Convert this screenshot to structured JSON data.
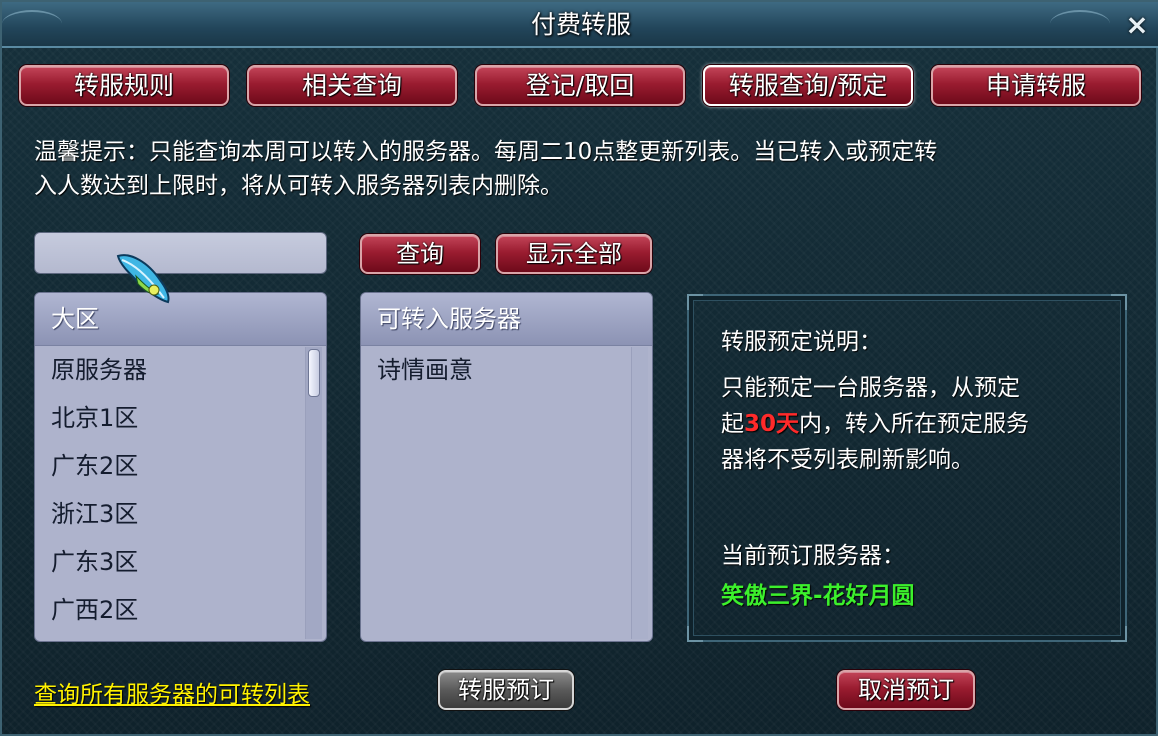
{
  "window": {
    "title": "付费转服",
    "close_label": "×"
  },
  "tabs": [
    {
      "label": "转服规则"
    },
    {
      "label": "相关查询"
    },
    {
      "label": "登记/取回"
    },
    {
      "label": "转服查询/预定",
      "selected": true
    },
    {
      "label": "申请转服"
    }
  ],
  "notice": {
    "line1": "温馨提示：只能查询本周可以转入的服务器。每周二10点整更新列表。当已转入或预定转",
    "line2": "入人数达到上限时，将从可转入服务器列表内删除。"
  },
  "search": {
    "value": "",
    "query_label": "查询",
    "show_all_label": "显示全部"
  },
  "region_list": {
    "header": "大区",
    "items": [
      "原服务器",
      "北京1区",
      "广东2区",
      "浙江3区",
      "广东3区",
      "广西2区"
    ]
  },
  "server_list": {
    "header": "可转入服务器",
    "items": [
      "诗情画意"
    ]
  },
  "info": {
    "heading": "转服预定说明：",
    "line1": "只能预定一台服务器，从预定",
    "line2_prefix": "起",
    "line2_highlight": "30天",
    "line2_suffix": "内，转入所在预定服务",
    "line3": "器将不受列表刷新影响。",
    "current_label": "当前预订服务器：",
    "current_value": "笑傲三界-花好月圆"
  },
  "footer": {
    "link_label": "查询所有服务器的可转列表",
    "reserve_label": "转服预订",
    "cancel_label": "取消预订"
  },
  "colors": {
    "button_red": "#9a1c30",
    "highlight_red": "#ff2a2a",
    "server_green": "#3cf02c",
    "link_yellow": "#fff200"
  }
}
